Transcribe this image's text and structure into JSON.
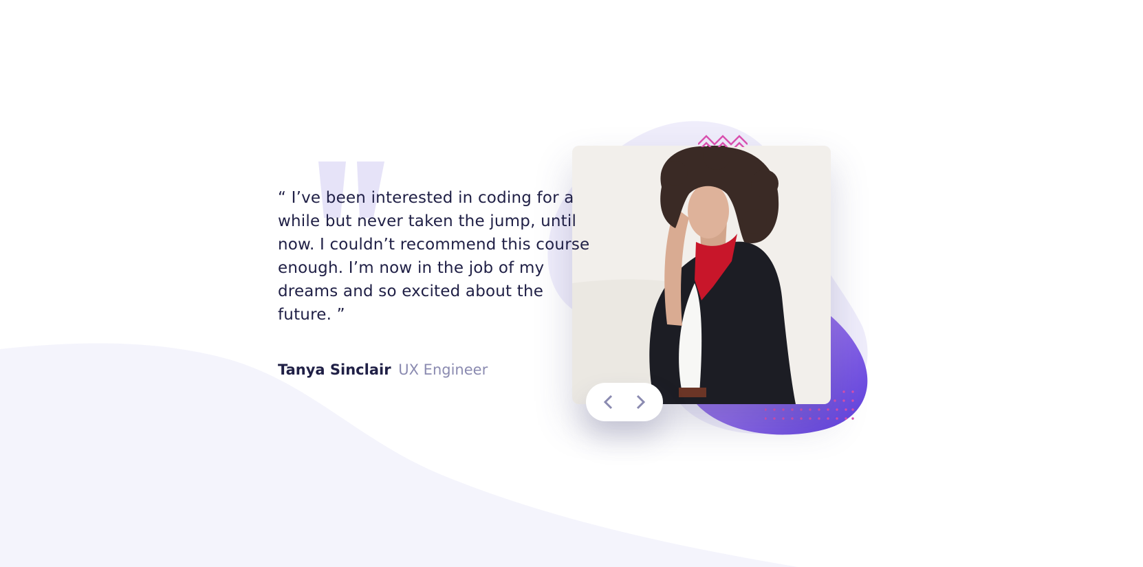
{
  "testimonial": {
    "quote": "“ I’ve been interested in coding for a while but never taken the jump, until now. I couldn’t recommend this course enough. I’m now in the job of my dreams and so excited about the future. ”",
    "author_name": "Tanya Sinclair",
    "author_role": "UX Engineer"
  },
  "image": {
    "alt": "Tanya Sinclair"
  },
  "navigation": {
    "prev_label": "Previous",
    "next_label": "Next",
    "prev_icon": "chevron-left-icon",
    "next_icon": "chevron-right-icon"
  },
  "colors": {
    "text_dark": "#202046",
    "text_muted": "#8a8ab0",
    "accent_purple": "#5b3ddb",
    "accent_pink": "#d84fae",
    "bg_curve": "#f4f4fc",
    "quote_mark": "#e6e3f8",
    "nav_arrow": "#8a8ab0"
  }
}
